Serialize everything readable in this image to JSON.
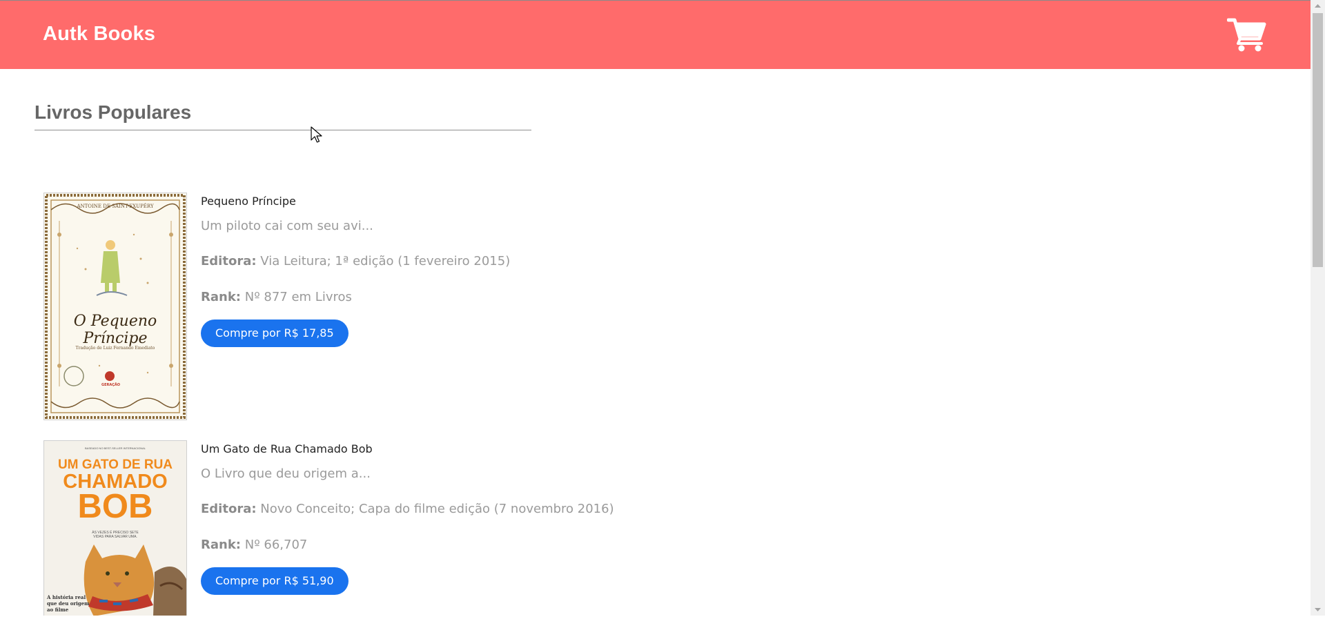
{
  "header": {
    "brand": "Autk Books",
    "cart_icon": "shopping-cart-icon"
  },
  "colors": {
    "header_bg": "#ff6b6b",
    "button_bg": "#1a73ee"
  },
  "section": {
    "title": "Livros Populares"
  },
  "labels": {
    "publisher": "Editora:",
    "rank": "Rank:"
  },
  "books": [
    {
      "title": "Pequeno Príncipe",
      "description": "Um piloto cai com seu avi...",
      "publisher": "Via Leitura; 1ª edição (1 fevereiro 2015)",
      "rank": "Nº 877 em Livros",
      "button": "Compre por R$ 17,85",
      "cover": {
        "author": "ANTOINE DE SAINT-EXUPÉRY",
        "title": "O Pequeno Príncipe",
        "translator": "Tradução de Luiz Fernando Emediato",
        "publisher": "GERAÇÃO"
      }
    },
    {
      "title": "Um Gato de Rua Chamado Bob",
      "description": "O Livro que deu origem a...",
      "publisher": "Novo Conceito; Capa do filme edição (7 novembro 2016)",
      "rank": "Nº 66,707",
      "button": "Compre por R$ 51,90",
      "cover": {
        "kicker": "BASEADO NO BEST-SELLER INTERNACIONAL",
        "title_line1": "UM GATO DE RUA",
        "title_line2": "CHAMADO",
        "title_line3": "BOB",
        "tagline": "ÀS VEZES É PRECISO SETE VIDAS PARA SALVAR UMA.",
        "footer": "A história real que deu origem ao filme"
      }
    }
  ]
}
